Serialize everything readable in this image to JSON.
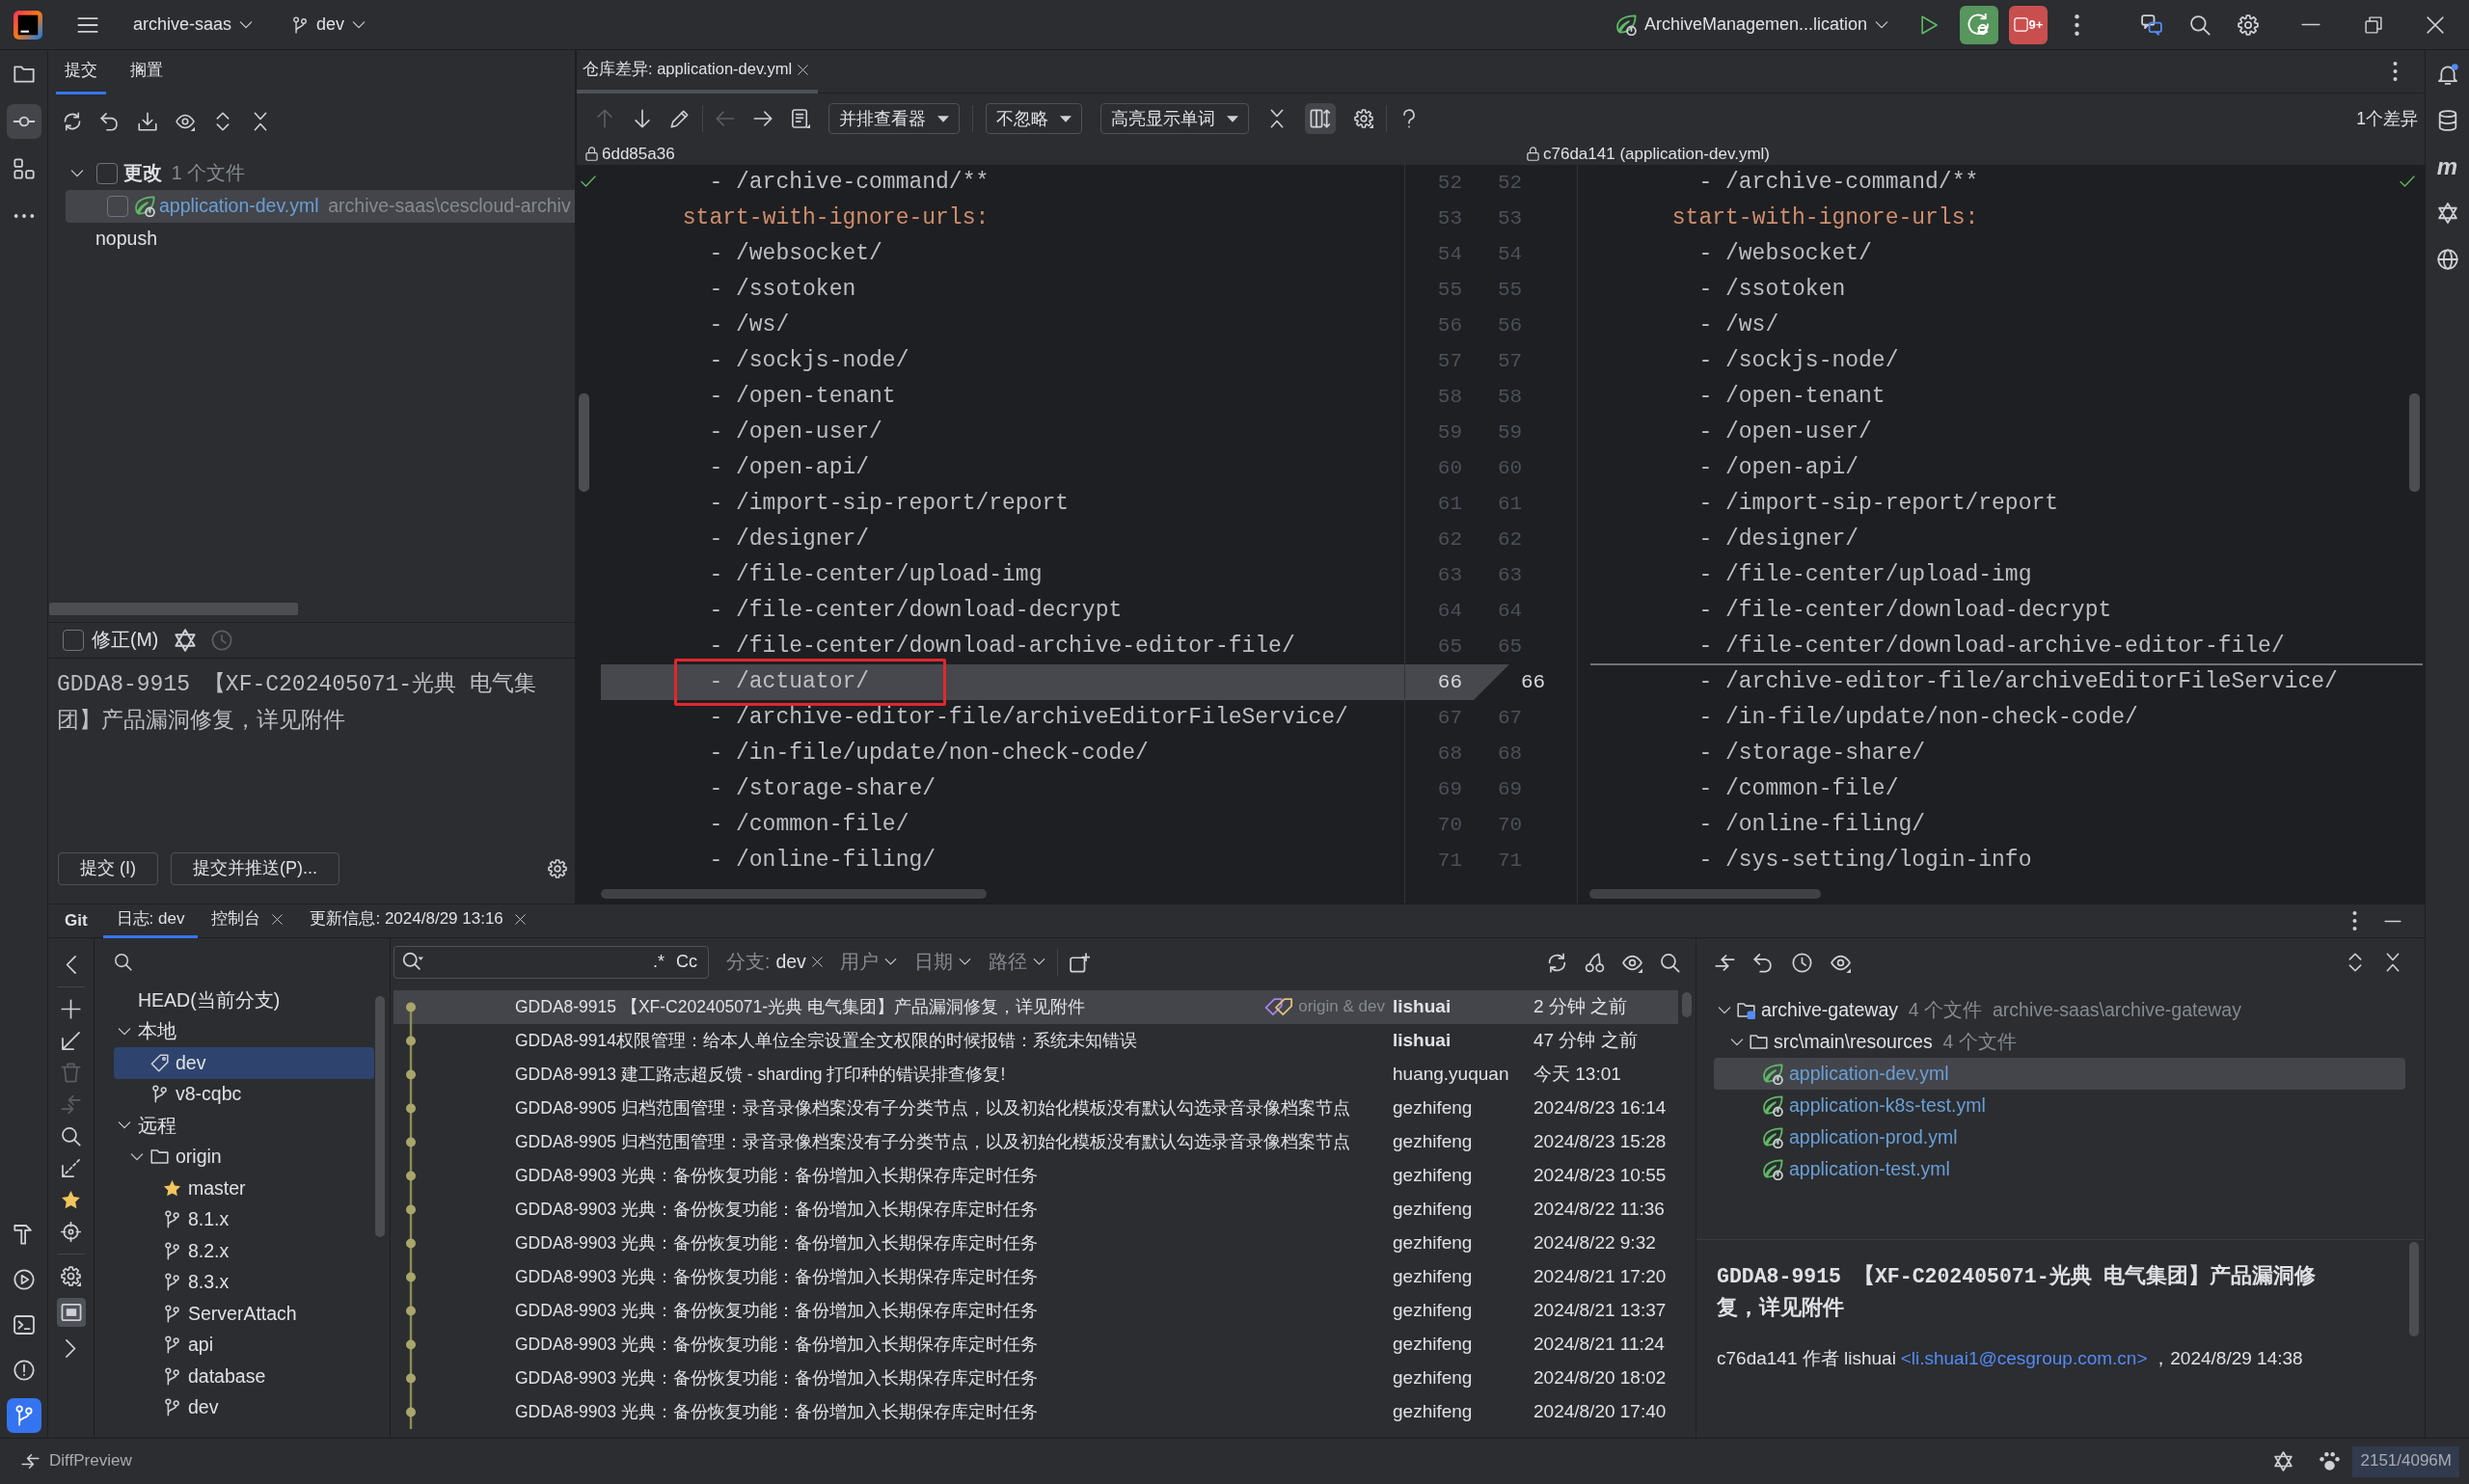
{
  "title_bar": {
    "project": "archive-saas",
    "branch": "dev",
    "run_configuration": "ArchiveManagemen...lication",
    "stop_count": "9+"
  },
  "left_stripe": {
    "top": [
      {
        "kind": "project",
        "selected": false,
        "focused": false
      },
      {
        "kind": "commit",
        "selected": true,
        "focused": false
      },
      {
        "kind": "structure",
        "selected": false,
        "focused": false
      },
      {
        "kind": "more",
        "selected": false,
        "focused": false
      }
    ],
    "bottom": [
      {
        "kind": "build",
        "selected": false,
        "focused": false
      },
      {
        "kind": "services",
        "selected": false,
        "focused": false
      },
      {
        "kind": "terminal",
        "selected": false,
        "focused": false
      },
      {
        "kind": "problems",
        "selected": false,
        "focused": false
      },
      {
        "kind": "git",
        "selected": true,
        "focused": true
      }
    ]
  },
  "right_stripe": [
    {
      "kind": "notifications"
    },
    {
      "kind": "database"
    },
    {
      "kind": "maven",
      "label": "m"
    },
    {
      "kind": "ai_assistant"
    },
    {
      "kind": "web"
    }
  ],
  "commit_panel": {
    "tabs": [
      {
        "label": "提交",
        "selected": true
      },
      {
        "label": "搁置",
        "selected": false
      }
    ],
    "changes": [
      {
        "kind": "changelist",
        "label": "更改",
        "count": "1 个文件",
        "expanded": true,
        "checked": false,
        "selected": false,
        "children": [
          {
            "kind": "file",
            "label": "application-dev.yml",
            "path": "archive-saas\\cescloud-archiv",
            "checked": false,
            "selected": true
          }
        ]
      },
      {
        "kind": "empty_changelist",
        "label": "nopush",
        "selected": false
      }
    ],
    "amend": {
      "label": "修正(M)",
      "checked": false
    },
    "message": "GDDA8-9915 【XF-C202405071-光典 电气集团】产品漏洞修复，详见附件",
    "buttons": [
      "提交 (I)",
      "提交并推送(P)..."
    ]
  },
  "diff": {
    "tab": "仓库差异: application-dev.yml",
    "toolbar": [
      {
        "kind": "previous",
        "disabled": true
      },
      {
        "kind": "next",
        "disabled": false
      },
      {
        "kind": "edit",
        "disabled": false
      },
      {
        "kind": "separator"
      },
      {
        "kind": "back",
        "disabled": true
      },
      {
        "kind": "forward",
        "disabled": false
      },
      {
        "kind": "document",
        "disabled": false
      },
      {
        "kind": "dropdown",
        "label": "并排查看器",
        "disabled": false
      },
      {
        "kind": "separator"
      },
      {
        "kind": "dropdown",
        "label": "不忽略",
        "disabled": false
      },
      {
        "kind": "dropdown",
        "label": "高亮显示单词",
        "disabled": false
      },
      {
        "kind": "collapse",
        "disabled": false
      },
      {
        "kind": "sync_scroll",
        "on": true,
        "disabled": false
      },
      {
        "kind": "settings",
        "disabled": false
      },
      {
        "kind": "separator"
      },
      {
        "kind": "help",
        "disabled": false
      }
    ],
    "difference_count": "1个差异",
    "left_revision": "6dd85a36",
    "right_revision": "c76da141 (application-dev.yml)",
    "left_lines": [
      {
        "number": "52",
        "kind": "item",
        "text": "- /archive-command/**",
        "deleted": false,
        "annotated": false
      },
      {
        "number": "53",
        "kind": "key",
        "text": "start-with-ignore-urls:",
        "deleted": false,
        "annotated": false
      },
      {
        "number": "54",
        "kind": "item",
        "text": "- /websocket/",
        "deleted": false,
        "annotated": false
      },
      {
        "number": "55",
        "kind": "item",
        "text": "- /ssotoken",
        "deleted": false,
        "annotated": false
      },
      {
        "number": "56",
        "kind": "item",
        "text": "- /ws/",
        "deleted": false,
        "annotated": false
      },
      {
        "number": "57",
        "kind": "item",
        "text": "- /sockjs-node/",
        "deleted": false,
        "annotated": false
      },
      {
        "number": "58",
        "kind": "item",
        "text": "- /open-tenant",
        "deleted": false,
        "annotated": false
      },
      {
        "number": "59",
        "kind": "item",
        "text": "- /open-user/",
        "deleted": false,
        "annotated": false
      },
      {
        "number": "60",
        "kind": "item",
        "text": "- /open-api/",
        "deleted": false,
        "annotated": false
      },
      {
        "number": "61",
        "kind": "item",
        "text": "- /import-sip-report/report",
        "deleted": false,
        "annotated": false
      },
      {
        "number": "62",
        "kind": "item",
        "text": "- /designer/",
        "deleted": false,
        "annotated": false
      },
      {
        "number": "63",
        "kind": "item",
        "text": "- /file-center/upload-img",
        "deleted": false,
        "annotated": false
      },
      {
        "number": "64",
        "kind": "item",
        "text": "- /file-center/download-decrypt",
        "deleted": false,
        "annotated": false
      },
      {
        "number": "65",
        "kind": "item",
        "text": "- /file-center/download-archive-editor-file/",
        "deleted": false,
        "annotated": false
      },
      {
        "number": "66",
        "kind": "item",
        "text": "- /actuator/",
        "deleted": true,
        "annotated": true
      },
      {
        "number": "67",
        "kind": "item",
        "text": "- /archive-editor-file/archiveEditorFileService/",
        "deleted": false,
        "annotated": false
      },
      {
        "number": "68",
        "kind": "item",
        "text": "- /in-file/update/non-check-code/",
        "deleted": false,
        "annotated": false
      },
      {
        "number": "69",
        "kind": "item",
        "text": "- /storage-share/",
        "deleted": false,
        "annotated": false
      },
      {
        "number": "70",
        "kind": "item",
        "text": "- /common-file/",
        "deleted": false,
        "annotated": false
      },
      {
        "number": "71",
        "kind": "item",
        "text": "- /online-filing/",
        "deleted": false,
        "annotated": false
      }
    ],
    "right_lines": [
      {
        "number": "52",
        "kind": "item",
        "text": "- /archive-command/**",
        "gap_above": false
      },
      {
        "number": "53",
        "kind": "key",
        "text": "start-with-ignore-urls:",
        "gap_above": false
      },
      {
        "number": "54",
        "kind": "item",
        "text": "- /websocket/",
        "gap_above": false
      },
      {
        "number": "55",
        "kind": "item",
        "text": "- /ssotoken",
        "gap_above": false
      },
      {
        "number": "56",
        "kind": "item",
        "text": "- /ws/",
        "gap_above": false
      },
      {
        "number": "57",
        "kind": "item",
        "text": "- /sockjs-node/",
        "gap_above": false
      },
      {
        "number": "58",
        "kind": "item",
        "text": "- /open-tenant",
        "gap_above": false
      },
      {
        "number": "59",
        "kind": "item",
        "text": "- /open-user/",
        "gap_above": false
      },
      {
        "number": "60",
        "kind": "item",
        "text": "- /open-api/",
        "gap_above": false
      },
      {
        "number": "61",
        "kind": "item",
        "text": "- /import-sip-report/report",
        "gap_above": false
      },
      {
        "number": "62",
        "kind": "item",
        "text": "- /designer/",
        "gap_above": false
      },
      {
        "number": "63",
        "kind": "item",
        "text": "- /file-center/upload-img",
        "gap_above": false
      },
      {
        "number": "64",
        "kind": "item",
        "text": "- /file-center/download-decrypt",
        "gap_above": false
      },
      {
        "number": "65",
        "kind": "item",
        "text": "- /file-center/download-archive-editor-file/",
        "gap_above": false
      },
      {
        "number": "66",
        "kind": "item",
        "text": "- /archive-editor-file/archiveEditorFileService/",
        "gap_above": true
      },
      {
        "number": "67",
        "kind": "item",
        "text": "- /in-file/update/non-check-code/",
        "gap_above": false
      },
      {
        "number": "68",
        "kind": "item",
        "text": "- /storage-share/",
        "gap_above": false
      },
      {
        "number": "69",
        "kind": "item",
        "text": "- /common-file/",
        "gap_above": false
      },
      {
        "number": "70",
        "kind": "item",
        "text": "- /online-filing/",
        "gap_above": false
      },
      {
        "number": "71",
        "kind": "item",
        "text": "- /sys-setting/login-info",
        "gap_above": false
      }
    ]
  },
  "git_panel": {
    "title": "Git",
    "tabs": [
      {
        "label": "日志: dev",
        "selected": true,
        "closable": false
      },
      {
        "label": "控制台",
        "selected": false,
        "closable": true
      },
      {
        "label": "更新信息: 2024/8/29 13:16",
        "selected": false,
        "closable": true
      }
    ],
    "toolbar": [
      {
        "kind": "hide",
        "disabled": false
      },
      {
        "kind": "separator"
      },
      {
        "kind": "new_branch",
        "disabled": false
      },
      {
        "kind": "update",
        "disabled": false
      },
      {
        "kind": "delete",
        "disabled": true
      },
      {
        "kind": "compare",
        "disabled": true
      },
      {
        "kind": "search",
        "disabled": false
      },
      {
        "kind": "pull",
        "disabled": false
      },
      {
        "kind": "favorite",
        "disabled": false
      },
      {
        "kind": "locate",
        "disabled": false
      },
      {
        "kind": "separator"
      },
      {
        "kind": "settings",
        "disabled": false
      },
      {
        "kind": "group",
        "on": true,
        "disabled": false
      },
      {
        "kind": "show",
        "disabled": false
      }
    ],
    "branches": [
      {
        "label": "HEAD(当前分支)",
        "selected": false
      },
      {
        "label": "本地",
        "expanded": true,
        "selected": false,
        "children": [
          {
            "kind": "current",
            "label": "dev",
            "selected": true
          },
          {
            "kind": "branch",
            "label": "v8-cqbc",
            "selected": false
          }
        ]
      },
      {
        "label": "远程",
        "expanded": true,
        "selected": false,
        "children": [
          {
            "kind": "remote",
            "label": "origin",
            "expanded": true,
            "selected": false,
            "children": [
              {
                "kind": "favorite",
                "label": "master",
                "selected": false
              },
              {
                "kind": "branch",
                "label": "8.1.x",
                "selected": false
              },
              {
                "kind": "branch",
                "label": "8.2.x",
                "selected": false
              },
              {
                "kind": "branch",
                "label": "8.3.x",
                "selected": false
              },
              {
                "kind": "branch",
                "label": "ServerAttach",
                "selected": false
              },
              {
                "kind": "branch",
                "label": "api",
                "selected": false
              },
              {
                "kind": "branch",
                "label": "database",
                "selected": false
              },
              {
                "kind": "branch",
                "label": "dev",
                "selected": false
              }
            ]
          }
        ]
      }
    ],
    "log_filter": {
      "search_options": [
        ".*",
        "Cc"
      ],
      "branch_label": "分支:",
      "branch": "dev",
      "filters": [
        "用户",
        "日期",
        "路径"
      ]
    },
    "commits": [
      {
        "message": "GDDA8-9915 【XF-C202405071-光典 电气集团】产品漏洞修复，详见附件",
        "refs": "origin & dev",
        "author": "lishuai",
        "date": "2 分钟 之前",
        "selected": true,
        "bold_author": true
      },
      {
        "message": "GDDA8-9914权限管理：给本人单位全宗设置全文权限的时候报错：系统未知错误",
        "author": "lishuai",
        "date": "47 分钟 之前",
        "selected": false,
        "bold_author": true
      },
      {
        "message": "GDDA8-9913 建工路志超反馈 - sharding 打印种的错误排查修复!",
        "author": "huang.yuquan",
        "date": "今天 13:01",
        "selected": false,
        "bold_author": false
      },
      {
        "message": "GDDA8-9905 归档范围管理：录音录像档案没有子分类节点，以及初始化模板没有默认勾选录音录像档案节点",
        "author": "gezhifeng",
        "date": "2024/8/23 16:14",
        "selected": false,
        "bold_author": false
      },
      {
        "message": "GDDA8-9905 归档范围管理：录音录像档案没有子分类节点，以及初始化模板没有默认勾选录音录像档案节点",
        "author": "gezhifeng",
        "date": "2024/8/23 15:28",
        "selected": false,
        "bold_author": false
      },
      {
        "message": "GDDA8-9903 光典：备份恢复功能：备份增加入长期保存库定时任务",
        "author": "gezhifeng",
        "date": "2024/8/23 10:55",
        "selected": false,
        "bold_author": false
      },
      {
        "message": "GDDA8-9903 光典：备份恢复功能：备份增加入长期保存库定时任务",
        "author": "gezhifeng",
        "date": "2024/8/22 11:36",
        "selected": false,
        "bold_author": false
      },
      {
        "message": "GDDA8-9903 光典：备份恢复功能：备份增加入长期保存库定时任务",
        "author": "gezhifeng",
        "date": "2024/8/22 9:32",
        "selected": false,
        "bold_author": false
      },
      {
        "message": "GDDA8-9903 光典：备份恢复功能：备份增加入长期保存库定时任务",
        "author": "gezhifeng",
        "date": "2024/8/21 17:20",
        "selected": false,
        "bold_author": false
      },
      {
        "message": "GDDA8-9903 光典：备份恢复功能：备份增加入长期保存库定时任务",
        "author": "gezhifeng",
        "date": "2024/8/21 13:37",
        "selected": false,
        "bold_author": false
      },
      {
        "message": "GDDA8-9903 光典：备份恢复功能：备份增加入长期保存库定时任务",
        "author": "gezhifeng",
        "date": "2024/8/21 11:24",
        "selected": false,
        "bold_author": false
      },
      {
        "message": "GDDA8-9903 光典：备份恢复功能：备份增加入长期保存库定时任务",
        "author": "gezhifeng",
        "date": "2024/8/20 18:02",
        "selected": false,
        "bold_author": false
      },
      {
        "message": "GDDA8-9903 光典：备份恢复功能：备份增加入长期保存库定时任务",
        "author": "gezhifeng",
        "date": "2024/8/20 17:40",
        "selected": false,
        "bold_author": false
      }
    ],
    "changes": [
      {
        "kind": "module",
        "label": "archive-gateway",
        "count": "4 个文件",
        "path": "archive-saas\\archive-gateway",
        "expanded": true,
        "selected": false,
        "children": [
          {
            "kind": "folder",
            "label": "src\\main\\resources",
            "count": "4 个文件",
            "expanded": true,
            "selected": false,
            "children": [
              {
                "kind": "file",
                "label": "application-dev.yml",
                "selected": true
              },
              {
                "kind": "file",
                "label": "application-k8s-test.yml",
                "selected": false
              },
              {
                "kind": "file",
                "label": "application-prod.yml",
                "selected": false
              },
              {
                "kind": "file",
                "label": "application-test.yml",
                "selected": false
              }
            ]
          }
        ]
      }
    ],
    "details": {
      "message": "GDDA8-9915 【XF-C202405071-光典 电气集团】产品漏洞修复，详见附件",
      "meta": "c76da141 作者 lishuai",
      "email": "<li.shuai1@cesgroup.com.cn>",
      "meta_end": "，2024/8/29 14:38"
    }
  },
  "status_bar": {
    "title": "DiffPreview",
    "memory": "2151/4096M"
  }
}
